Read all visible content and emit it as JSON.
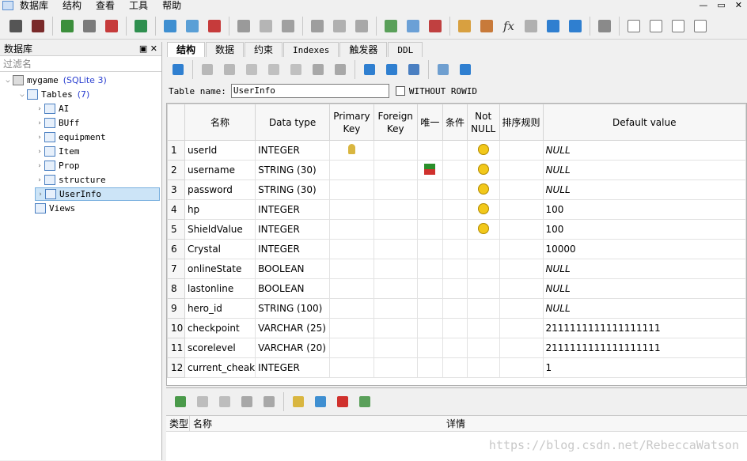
{
  "menu": [
    "数据库",
    "结构",
    "查看",
    "工具",
    "帮助"
  ],
  "window_controls": [
    "—",
    "▭",
    "✕"
  ],
  "left_panel": {
    "title": "数据库",
    "controls": "▣ ✕",
    "filter_placeholder": "过滤名",
    "db_name": "mygame",
    "db_type": "(SQLite 3)",
    "tables_label": "Tables",
    "tables_count": "(7)",
    "tables": [
      "AI",
      "BUff",
      "equipment",
      "Item",
      "Prop",
      "structure",
      "UserInfo"
    ],
    "views_label": "Views"
  },
  "tabs": [
    "结构",
    "数据",
    "约束",
    "Indexes",
    "触发器",
    "DDL"
  ],
  "table_name_label": "Table name:",
  "table_name_value": "UserInfo",
  "without_rowid_label": "WITHOUT ROWID",
  "columns_header": [
    "名称",
    "Data type",
    "Primary Key",
    "Foreign Key",
    "唯一",
    "条件",
    "Not NULL",
    "排序规则",
    "Default value"
  ],
  "rows": [
    {
      "n": "1",
      "name": "userId",
      "type": "INTEGER",
      "pk": true,
      "uniq": false,
      "notnull": true,
      "def": "NULL",
      "defnull": true
    },
    {
      "n": "2",
      "name": "username",
      "type": "STRING (30)",
      "pk": false,
      "uniq": true,
      "notnull": true,
      "def": "NULL",
      "defnull": true
    },
    {
      "n": "3",
      "name": "password",
      "type": "STRING (30)",
      "pk": false,
      "uniq": false,
      "notnull": true,
      "def": "NULL",
      "defnull": true
    },
    {
      "n": "4",
      "name": "hp",
      "type": "INTEGER",
      "pk": false,
      "uniq": false,
      "notnull": true,
      "def": "100",
      "defnull": false
    },
    {
      "n": "5",
      "name": "ShieldValue",
      "type": "INTEGER",
      "pk": false,
      "uniq": false,
      "notnull": true,
      "def": "100",
      "defnull": false
    },
    {
      "n": "6",
      "name": "Crystal",
      "type": "INTEGER",
      "pk": false,
      "uniq": false,
      "notnull": false,
      "def": "10000",
      "defnull": false
    },
    {
      "n": "7",
      "name": "onlineState",
      "type": "BOOLEAN",
      "pk": false,
      "uniq": false,
      "notnull": false,
      "def": "NULL",
      "defnull": true
    },
    {
      "n": "8",
      "name": "lastonline",
      "type": "BOOLEAN",
      "pk": false,
      "uniq": false,
      "notnull": false,
      "def": "NULL",
      "defnull": true
    },
    {
      "n": "9",
      "name": "hero_id",
      "type": "STRING (100)",
      "pk": false,
      "uniq": false,
      "notnull": false,
      "def": "NULL",
      "defnull": true
    },
    {
      "n": "10",
      "name": "checkpoint",
      "type": "VARCHAR (25)",
      "pk": false,
      "uniq": false,
      "notnull": false,
      "def": "2111111111111111111",
      "defnull": false
    },
    {
      "n": "11",
      "name": "scorelevel",
      "type": "VARCHAR (20)",
      "pk": false,
      "uniq": false,
      "notnull": false,
      "def": "2111111111111111111",
      "defnull": false
    },
    {
      "n": "12",
      "name": "current_cheak",
      "type": "INTEGER",
      "pk": false,
      "uniq": false,
      "notnull": false,
      "def": "1",
      "defnull": false
    }
  ],
  "bottom_header": [
    "类型",
    "名称",
    "详情"
  ],
  "watermark": "https://blog.csdn.net/RebeccaWatson",
  "toolbar_glyph": "fx",
  "colors": {
    "selection": "#cce4f7",
    "accent": "#2a3fd0"
  }
}
